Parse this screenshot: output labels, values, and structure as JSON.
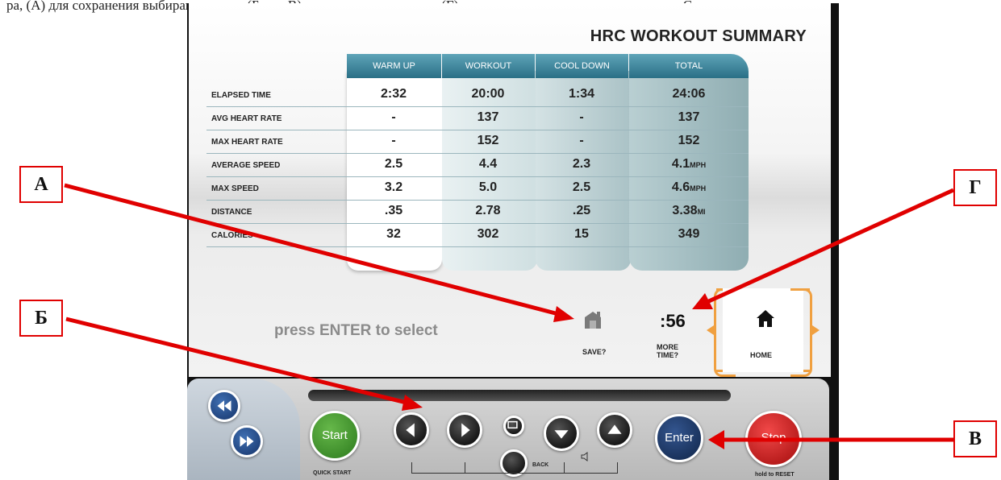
{
  "caption_fragment": "ра, (А) для сохранения выбирают значок (Б или В) для выхода, нажимают (Г) для изменения времени задерживают Стоп,",
  "screen": {
    "title": "HRC WORKOUT SUMMARY",
    "columns": [
      "WARM UP",
      "WORKOUT",
      "COOL DOWN",
      "TOTAL"
    ],
    "rows": [
      {
        "label": "ELAPSED TIME",
        "values": [
          "2:32",
          "20:00",
          "1:34",
          "24:06"
        ],
        "unit": ""
      },
      {
        "label": "AVG HEART RATE",
        "values": [
          "-",
          "137",
          "-",
          "137"
        ],
        "unit": ""
      },
      {
        "label": "MAX HEART RATE",
        "values": [
          "-",
          "152",
          "-",
          "152"
        ],
        "unit": ""
      },
      {
        "label": "AVERAGE SPEED",
        "values": [
          "2.5",
          "4.4",
          "2.3",
          "4.1"
        ],
        "unit": "MPH"
      },
      {
        "label": "MAX SPEED",
        "values": [
          "3.2",
          "5.0",
          "2.5",
          "4.6"
        ],
        "unit": "MPH"
      },
      {
        "label": "DISTANCE",
        "values": [
          ".35",
          "2.78",
          ".25",
          "3.38"
        ],
        "unit": "MI"
      },
      {
        "label": "CALORIES",
        "values": [
          "32",
          "302",
          "15",
          "349"
        ],
        "unit": ""
      }
    ],
    "press_text": "press ENTER to select",
    "save_label": "SAVE?",
    "timer": ":56",
    "more_time_line1": "MORE",
    "more_time_line2": "TIME?",
    "home_label": "HOME"
  },
  "console": {
    "start_label": "Start",
    "quick_start_label": "QUICK START",
    "back_label": "BACK",
    "enter_label": "Enter",
    "stop_label": "Stop",
    "hold_reset_label": "hold to RESET"
  },
  "callouts": {
    "a": "А",
    "b": "Б",
    "c": "В",
    "d": "Г"
  },
  "colors": {
    "callout_red": "#e00000",
    "accent_orange": "#f0a040",
    "header_teal": "#2a6f86"
  }
}
